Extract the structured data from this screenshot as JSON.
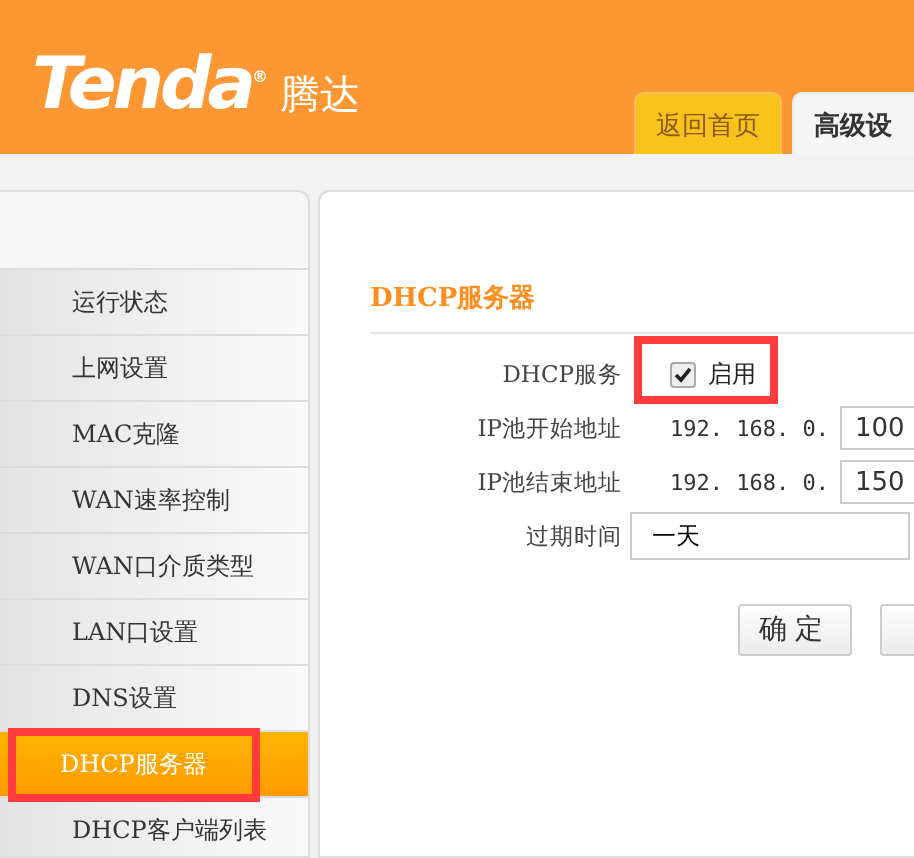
{
  "header": {
    "logo": "Tenda$^{®}$",
    "logo_suffix": "腾达"
  },
  "tabs": [
    {
      "label": "返回首页",
      "selected": false
    },
    {
      "label": "高级设",
      "selected": true
    }
  ],
  "sidebar": {
    "items": [
      {
        "label": "运行状态",
        "selected": false,
        "highlighted": false
      },
      {
        "label": "上网设置",
        "selected": false,
        "highlighted": false
      },
      {
        "label": "MAC克隆",
        "selected": false,
        "highlighted": false
      },
      {
        "label": "WAN速率控制",
        "selected": false,
        "highlighted": false
      },
      {
        "label": "WAN口介质类型",
        "selected": false,
        "highlighted": false
      },
      {
        "label": "LAN口设置",
        "selected": false,
        "highlighted": false
      },
      {
        "label": "DNS设置",
        "selected": false,
        "highlighted": false
      },
      {
        "label": "DHCP服务器",
        "selected": true,
        "highlighted": true
      },
      {
        "label": "DHCP客户端列表",
        "selected": false,
        "highlighted": false
      }
    ]
  },
  "panel": {
    "title": "DHCP服务器",
    "rows": [
      {
        "kind": "checkbox",
        "label": "DHCP服务",
        "checked": true,
        "option": "启用",
        "highlighted": true
      },
      {
        "kind": "ip",
        "label": "IP池开始地址",
        "prefix": "192. 168. 0.",
        "value": "100"
      },
      {
        "kind": "ip",
        "label": "IP池结束地址",
        "prefix": "192. 168. 0.",
        "value": "150"
      },
      {
        "kind": "select",
        "label": "过期时间",
        "value": "一天"
      }
    ],
    "buttons": [
      {
        "kind": "labeled",
        "label": "确定"
      },
      {
        "kind": "clipped"
      }
    ]
  }
}
